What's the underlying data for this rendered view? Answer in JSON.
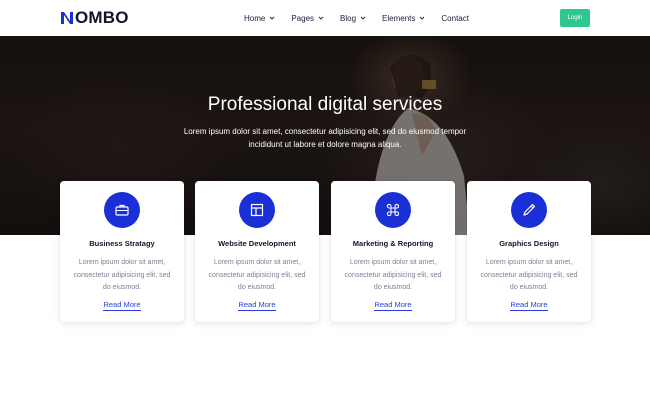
{
  "brand": {
    "name": "OMBO",
    "accent": "#1a2fd6",
    "green": "#2ec78e"
  },
  "header": {
    "nav": [
      {
        "label": "Home",
        "has_dropdown": true
      },
      {
        "label": "Pages",
        "has_dropdown": true
      },
      {
        "label": "Blog",
        "has_dropdown": true
      },
      {
        "label": "Elements",
        "has_dropdown": true
      },
      {
        "label": "Contact",
        "has_dropdown": false
      }
    ],
    "login_label": "Login"
  },
  "hero": {
    "title": "Professional digital services",
    "subtitle": "Lorem ipsum dolor sit amet, consectetur adipisicing elit, sed do eiusmod tempor incididunt ut labore et dolore magna aliqua."
  },
  "services": [
    {
      "icon": "briefcase-icon",
      "title": "Business Stratagy",
      "text": "Lorem ipsum dolor sit amet, consectetur adipisicing elit, sed do eiusmod.",
      "link": "Read More"
    },
    {
      "icon": "layout-icon",
      "title": "Website Development",
      "text": "Lorem ipsum dolor sit amet, consectetur adipisicing elit, sed do eiusmod.",
      "link": "Read More"
    },
    {
      "icon": "command-icon",
      "title": "Marketing & Reporting",
      "text": "Lorem ipsum dolor sit amet, consectetur adipisicing elit, sed do eiusmod.",
      "link": "Read More"
    },
    {
      "icon": "pen-icon",
      "title": "Graphics Design",
      "text": "Lorem ipsum dolor sit amet, consectetur adipisicing elit, sed do eiusmod.",
      "link": "Read More"
    }
  ]
}
